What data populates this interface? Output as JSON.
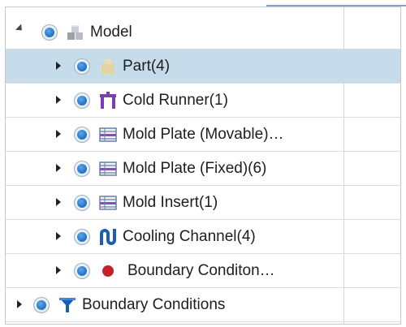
{
  "tree": {
    "items": [
      {
        "label": "Model",
        "icon": "model-blocks-icon",
        "expanded": true
      },
      {
        "label": "Part(4)",
        "icon": "part-icon",
        "expanded": false,
        "selected": true
      },
      {
        "label": "Cold Runner(1)",
        "icon": "cold-runner-icon",
        "expanded": false
      },
      {
        "label": "Mold Plate (Movable)…",
        "icon": "mold-plate-icon",
        "expanded": false
      },
      {
        "label": "Mold Plate (Fixed)(6)",
        "icon": "mold-plate-icon",
        "expanded": false
      },
      {
        "label": "Mold Insert(1)",
        "icon": "mold-plate-icon",
        "expanded": false
      },
      {
        "label": "Cooling Channel(4)",
        "icon": "cooling-channel-icon",
        "expanded": false
      },
      {
        "label": "Boundary Conditon…",
        "icon": "red-dot-icon",
        "expanded": false
      },
      {
        "label": "Boundary Conditions",
        "icon": "boundary-conditions-icon",
        "expanded": false
      }
    ]
  },
  "colors": {
    "selected_row": "#c7dceb",
    "radio_blue": "#1f6fc4",
    "runner_purple": "#7a3fb0",
    "cooling_blue": "#1a5fb4",
    "boundary_red": "#c8202a",
    "part_tan": "#e2d3a0"
  }
}
